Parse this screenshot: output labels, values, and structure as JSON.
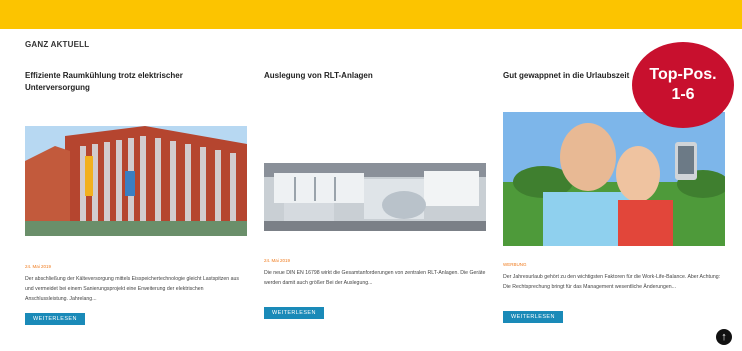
{
  "section": {
    "title": "GANZ AKTUELL"
  },
  "cards": [
    {
      "title": "Effiziente Raumkühlung trotz elektrischer Unterversorgung",
      "date": "24. Mai 2019",
      "text": "Der abschließung der Kälteversorgung mittels Eisspeichertechnologie gleicht Lastspitzen aus und vermeidet bei einem Sanierungsprojekt eine Erweiterung der elektrischen Anschlussleistung. Jahrelang...",
      "button": "WEITERLESEN"
    },
    {
      "title": "Auslegung von RLT-Anlagen",
      "date": "24. Mai 2019",
      "text": "Die neue DIN EN 16798 wirkt die Gesamtanforderungen von zentralen RLT-Anlagen. Die Geräte werden damit auch größer Bei der Auslegung...",
      "button": "WEITERLESEN"
    },
    {
      "title": "Gut gewappnet in die Urlaubszeit",
      "date": "WERBUNG",
      "text": "Der Jahresurlaub gehört zu den wichtigsten Faktoren für die Work-Life-Balance. Aber Achtung: Die Rechtsprechung bringt für das Management wesentliche Änderungen...",
      "button": "WEITERLESEN"
    }
  ],
  "badge": {
    "line1": "Top-Pos.",
    "line2": "1-6"
  },
  "scroll_top": {
    "icon": "arrow-up-icon",
    "glyph": "↑"
  },
  "colors": {
    "topbar": "#fcc400",
    "accent": "#1a8ab8",
    "date": "#f07b1d",
    "badge": "#c8102e"
  }
}
